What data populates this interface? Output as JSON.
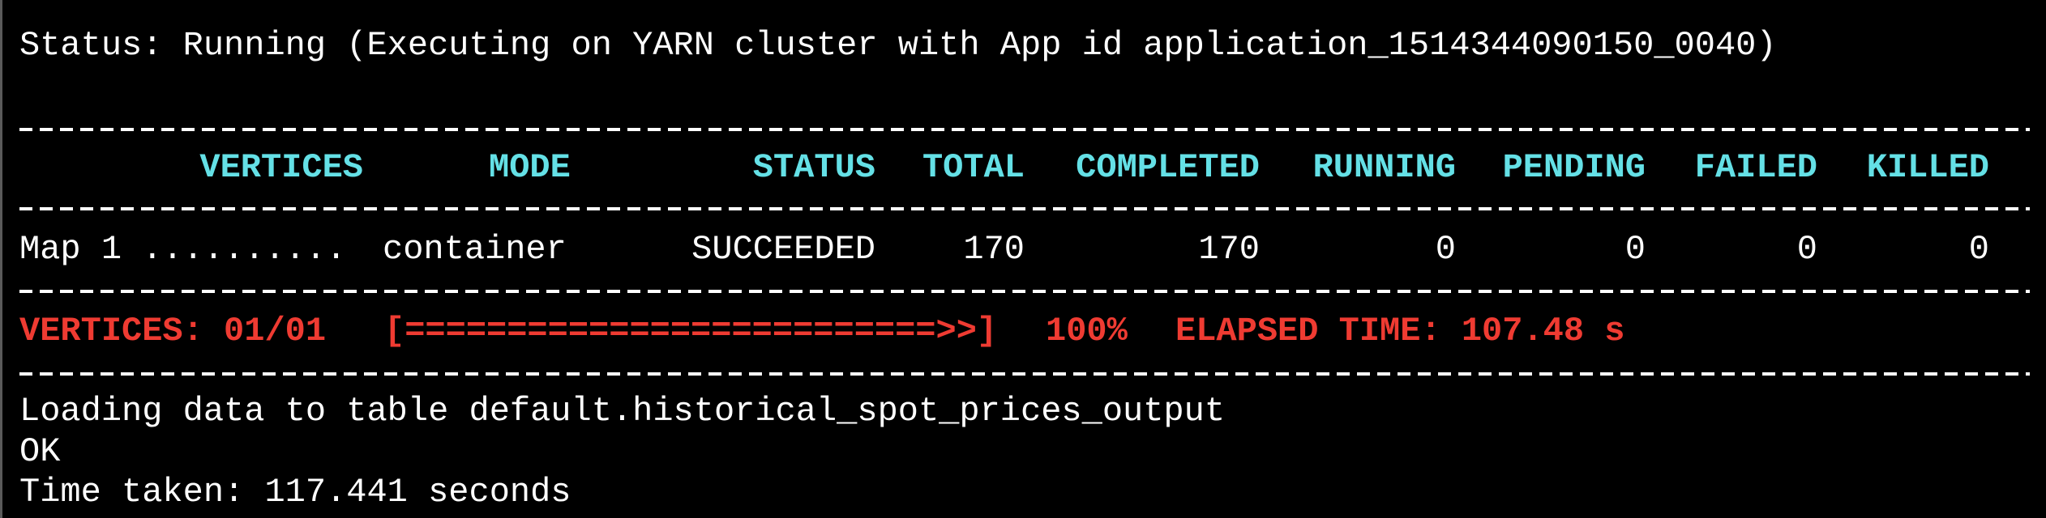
{
  "status_line": "Status: Running (Executing on YARN cluster with App id application_1514344090150_0040)",
  "table": {
    "headers": [
      "VERTICES",
      "MODE",
      "STATUS",
      "TOTAL",
      "COMPLETED",
      "RUNNING",
      "PENDING",
      "FAILED",
      "KILLED"
    ],
    "rows": [
      [
        "Map 1 ..........",
        "container",
        "SUCCEEDED",
        "170",
        "170",
        "0",
        "0",
        "0",
        "0"
      ]
    ]
  },
  "progress": {
    "vertices": "VERTICES: 01/01",
    "bar": "[==========================>>]",
    "percent": "100%",
    "percent_value": 100,
    "elapsed": "ELAPSED TIME: 107.48 s"
  },
  "output_lines": [
    "Loading data to table default.historical_spot_prices_output",
    "OK",
    "Time taken: 117.441 seconds"
  ],
  "colors": {
    "background": "#000000",
    "text": "#ffffff",
    "header": "#64e0e6",
    "progress": "#ef3b32"
  }
}
